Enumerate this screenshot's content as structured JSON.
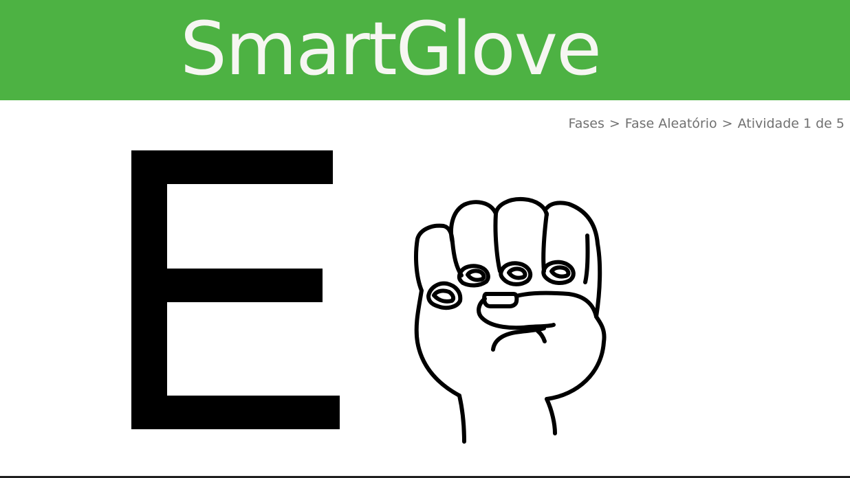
{
  "header": {
    "title": "SmartGlove",
    "color": "#4db243"
  },
  "breadcrumb": {
    "items": [
      "Fases",
      "Fase Aleatório",
      "Atividade 1 de 5"
    ],
    "separator": ">"
  },
  "activity": {
    "letter": "E",
    "sign_image": "hand-sign-letter-e-icon"
  }
}
